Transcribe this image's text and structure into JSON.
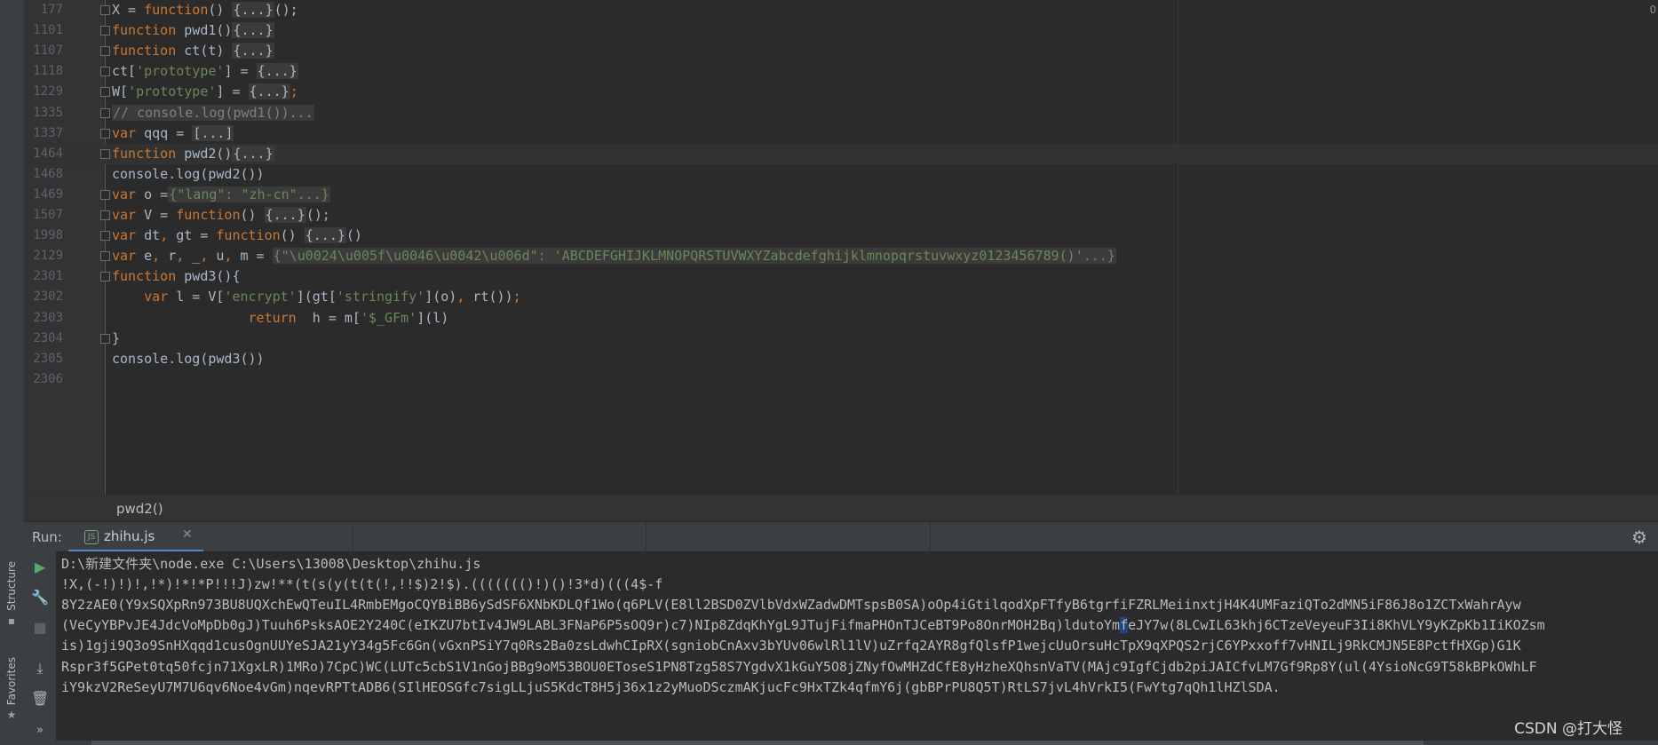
{
  "sidebar": {
    "structure_label": "Structure",
    "favorites_label": "Favorites"
  },
  "editor": {
    "right_marker": "O",
    "lines": [
      {
        "no": "177",
        "fold": true,
        "segs": [
          [
            "",
            "X = "
          ],
          [
            "kw",
            "function"
          ],
          [
            "",
            "() "
          ],
          [
            "fd",
            "{...}"
          ],
          [
            "",
            "();"
          ]
        ]
      },
      {
        "no": "1101",
        "fold": true,
        "segs": [
          [
            "kw",
            "function "
          ],
          [
            "",
            "pwd1()"
          ],
          [
            "fd",
            "{...}"
          ]
        ]
      },
      {
        "no": "1107",
        "fold": true,
        "segs": [
          [
            "kw",
            "function "
          ],
          [
            "",
            "ct(t) "
          ],
          [
            "fd",
            "{...}"
          ]
        ]
      },
      {
        "no": "1118",
        "fold": true,
        "segs": [
          [
            "",
            "ct["
          ],
          [
            "str",
            "'prototype'"
          ],
          [
            "",
            "] = "
          ],
          [
            "fd",
            "{...}"
          ]
        ]
      },
      {
        "no": "1229",
        "fold": true,
        "segs": [
          [
            "",
            "W["
          ],
          [
            "str",
            "'prototype'"
          ],
          [
            "",
            "] = "
          ],
          [
            "fd",
            "{...}"
          ],
          [
            "kw",
            ";"
          ]
        ]
      },
      {
        "no": "1335",
        "fold": true,
        "segs": [
          [
            "fd-cm",
            "// console.log(pwd1())..."
          ]
        ]
      },
      {
        "no": "1337",
        "fold": true,
        "segs": [
          [
            "kw",
            "var "
          ],
          [
            "",
            "qqq = "
          ],
          [
            "fd",
            "[...]"
          ]
        ]
      },
      {
        "no": "1464",
        "fold": true,
        "current": true,
        "segs": [
          [
            "kw",
            "function "
          ],
          [
            "",
            "pwd2()"
          ],
          [
            "fd",
            "{...}"
          ]
        ]
      },
      {
        "no": "1468",
        "fold": false,
        "segs": [
          [
            "",
            "console.log(pwd2())"
          ]
        ]
      },
      {
        "no": "1469",
        "fold": true,
        "segs": [
          [
            "kw",
            "var "
          ],
          [
            "",
            "o ="
          ],
          [
            "fd-str",
            "{\"lang\": \"zh-cn\"...}"
          ]
        ]
      },
      {
        "no": "1507",
        "fold": true,
        "segs": [
          [
            "kw",
            "var "
          ],
          [
            "",
            "V = "
          ],
          [
            "kw",
            "function"
          ],
          [
            "",
            "() "
          ],
          [
            "fd",
            "{...}"
          ],
          [
            "",
            "();"
          ]
        ]
      },
      {
        "no": "1998",
        "fold": true,
        "segs": [
          [
            "kw",
            "var "
          ],
          [
            "",
            "dt"
          ],
          [
            "kw",
            ", "
          ],
          [
            "",
            "gt = "
          ],
          [
            "kw",
            "function"
          ],
          [
            "",
            "() "
          ],
          [
            "fd",
            "{...}"
          ],
          [
            "",
            "()"
          ]
        ]
      },
      {
        "no": "2129",
        "fold": true,
        "segs": [
          [
            "kw",
            "var "
          ],
          [
            "",
            "e"
          ],
          [
            "kw",
            ", "
          ],
          [
            "",
            "r"
          ],
          [
            "kw",
            ", "
          ],
          [
            "",
            "_"
          ],
          [
            "kw",
            ", "
          ],
          [
            "",
            "u"
          ],
          [
            "kw",
            ", "
          ],
          [
            "",
            "m = "
          ],
          [
            "fd-str",
            "{\"\\u0024\\u005f\\u0046\\u0042\\u006d\": 'ABCDEFGHIJKLMNOPQRSTUVWXYZabcdefghijklmnopqrstuvwxyz0123456789()'...}"
          ]
        ]
      },
      {
        "no": "2301",
        "fold": true,
        "segs": [
          [
            "kw",
            "function "
          ],
          [
            "",
            "pwd3(){"
          ]
        ]
      },
      {
        "no": "2302",
        "fold": false,
        "segs": [
          [
            "",
            "    "
          ],
          [
            "kw",
            "var "
          ],
          [
            "",
            "l = V["
          ],
          [
            "str",
            "'encrypt'"
          ],
          [
            "",
            "](gt["
          ],
          [
            "str",
            "'stringify'"
          ],
          [
            "",
            "](o)"
          ],
          [
            "kw",
            ", "
          ],
          [
            "",
            "rt())"
          ],
          [
            "kw",
            ";"
          ]
        ]
      },
      {
        "no": "2303",
        "fold": false,
        "segs": [
          [
            "",
            "                 "
          ],
          [
            "kw",
            "return  "
          ],
          [
            "",
            "h = m["
          ],
          [
            "str",
            "'$_GFm'"
          ],
          [
            "",
            "](l)"
          ]
        ]
      },
      {
        "no": "2304",
        "fold": true,
        "segs": [
          [
            "",
            "}"
          ]
        ]
      },
      {
        "no": "2305",
        "fold": false,
        "segs": [
          [
            "",
            "console.log(pwd3())"
          ]
        ]
      },
      {
        "no": "2306",
        "fold": false,
        "segs": []
      }
    ]
  },
  "breadcrumb": {
    "path": "pwd2()"
  },
  "run": {
    "label": "Run:",
    "tab_label": "zhihu.js",
    "console_lines": [
      "D:\\新建文件夹\\node.exe C:\\Users\\13008\\Desktop\\zhihu.js",
      "!X,(-!)!)!,!*)!*!*P!!!J)zw!**(t(s(y(t(t(!,!!$)2!$).((((((()!)()!3*d)(((4$-f",
      "8Y2zAE0(Y9xSQXpRn973BU8UQXchEwQTeuIL4RmbEMgoCQYBiBB6ySdSF6XNbKDLQf1Wo(q6PLV(E8ll2BSD0ZVlbVdxWZadwDMTspsB0SA)oOp4iGtilqodXpFTfyB6tgrfiFZRLMeiinxtjH4K4UMFaziQTo2dMN5iF86J8o1ZCTxWahrAyw",
      [
        "(VeCyYBPvJE4JdcVoMpDb0gJ)Tuuh6PsksAOE2Y240C(eIKZU7btIv4JW9LABL3FNaP6P5sOQ9r)c7)NIp8ZdqKhYgL9JTujFifmaPHOnTJCeBT9Po8OnrMOH2Bq)ldutoYm",
        "f",
        "eJY7w(8LCwIL63khj6CTzeVeyeuF3Ii8KhVLY9yKZpKb1IiKOZsm"
      ],
      "is)1gji9Q3o9SnHXqqd1cusOgnUUYeSJA21yY34g5Fc6Gn(vGxnPSiY7q0Rs2Ba0zsLdwhCIpRX(sgniobCnAxv3bYUv06wlRl1lV)uZrfq2AYR8gfQlsfP1wejcUuOrsuHcTpX9qXPQS2rjC6YPxxoff7vHNILj9RkCMJN5E8PctfHXGp)G1K",
      "Rspr3f5GPet0tq50fcjn71XgxLR)1MRo)7CpC)WC(LUTc5cbS1V1nGojBBg9oM53BOU0EToseS1PN8Tzg58S7YgdvX1kGuY5O8jZNyfOwMHZdCfE8yHzheXQhsnVaTV(MAjc9IgfCjdb2piJAICfvLM7Gf9Rp8Y(ul(4YsioNcG9T58kBPkOWhLF",
      "iY9kzV2ReSeyU7M7U6qv6Noe4vGm)nqevRPTtADB6(SIlHEOSGfc7sigLLjuS5KdcT8H5j36x1z2yMuoDSczmAKjucFc9HxTZk4qfmY6j(gbBPrPU8Q5T)RtLS7jvL4hVrkI5(FwYtg7qQh1lHZlSDA."
    ]
  },
  "watermark": "CSDN @打大怪"
}
